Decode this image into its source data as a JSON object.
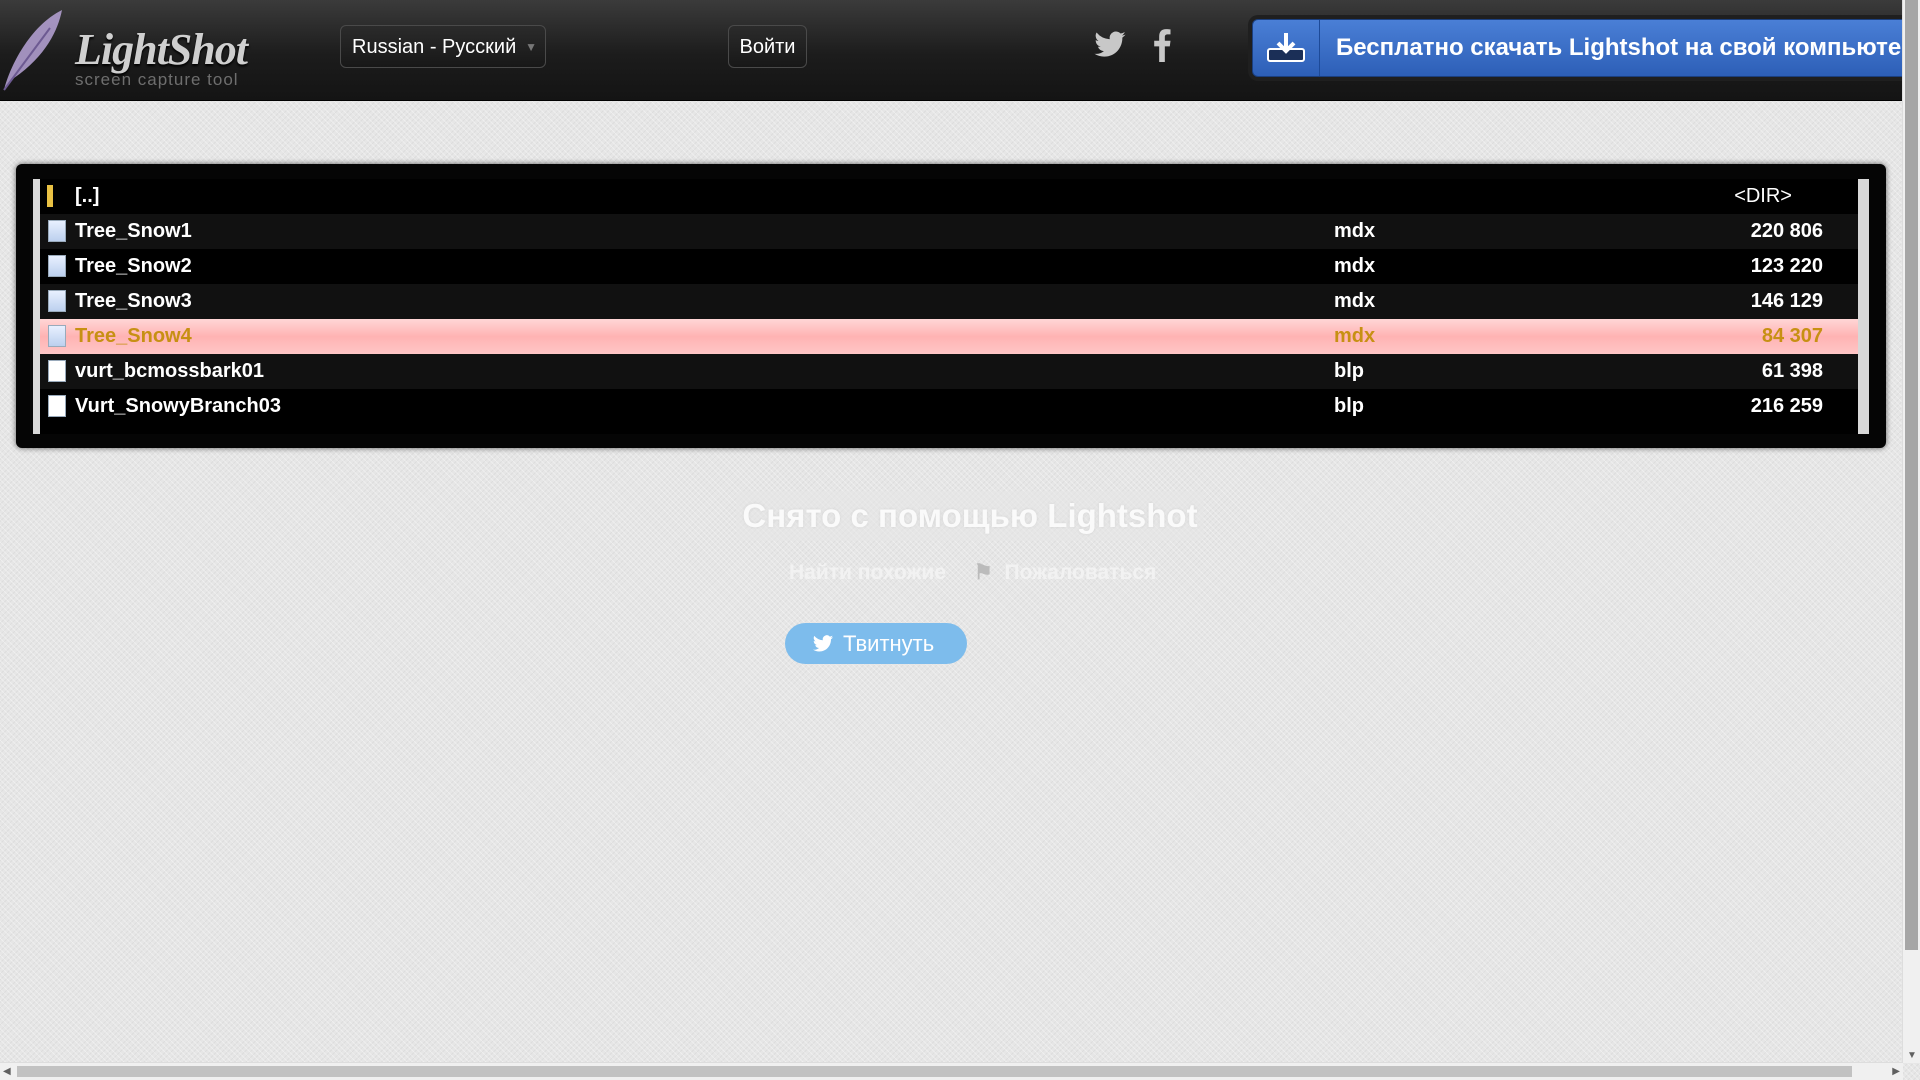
{
  "header": {
    "logo_text": "LightShot",
    "logo_sub": "screen capture tool",
    "language": "Russian - Русский",
    "login": "Войти",
    "download": "Бесплатно скачать Lightshot на свой компьюте"
  },
  "screenshot": {
    "rows": [
      {
        "name": "[..]",
        "ext": "",
        "size": "",
        "tag": "<DIR>",
        "type": "folder"
      },
      {
        "name": "Tree_Snow1",
        "ext": "mdx",
        "size": "220 806",
        "type": "doc"
      },
      {
        "name": "Tree_Snow2",
        "ext": "mdx",
        "size": "123 220",
        "type": "doc"
      },
      {
        "name": "Tree_Snow3",
        "ext": "mdx",
        "size": "146 129",
        "type": "doc"
      },
      {
        "name": "Tree_Snow4",
        "ext": "mdx",
        "size": "84 307",
        "type": "doc",
        "selected": true
      },
      {
        "name": "vurt_bcmossbark01",
        "ext": "blp",
        "size": "61 398",
        "type": "file"
      },
      {
        "name": "Vurt_SnowyBranch03",
        "ext": "blp",
        "size": "216 259",
        "type": "file"
      }
    ]
  },
  "caption": "Снято с помощью Lightshot",
  "sublinks": {
    "similar": "Найти похожие",
    "report": "Пожаловаться"
  },
  "tweet": "Твитнуть",
  "colors": {
    "accent": "#2d5fb7",
    "selected_row": "#ffb3b3",
    "tweet": "#7dbcec"
  }
}
